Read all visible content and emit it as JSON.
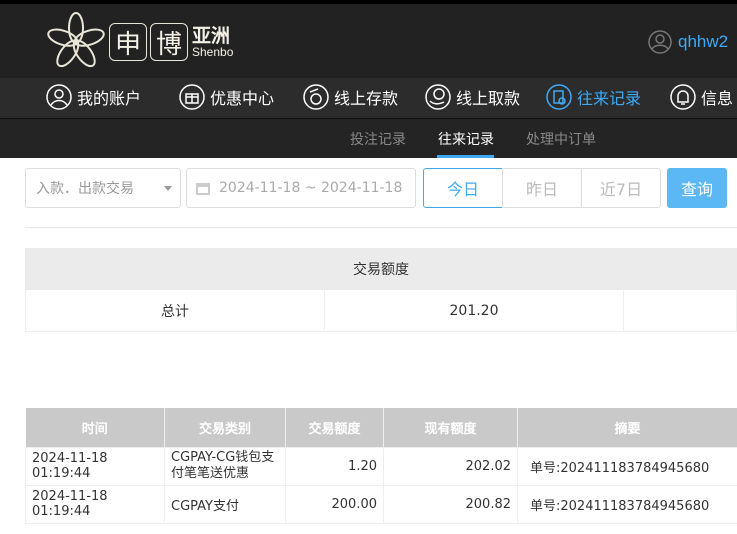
{
  "brand": {
    "char1": "申",
    "char2": "博",
    "cn": "亚洲",
    "en": "Shenbo"
  },
  "user": {
    "name": "qhhw2",
    "icon": "user-circle-icon"
  },
  "nav": [
    {
      "label": "我的账户",
      "icon": "user-icon"
    },
    {
      "label": "优惠中心",
      "icon": "gift-icon"
    },
    {
      "label": "线上存款",
      "icon": "deposit-icon"
    },
    {
      "label": "线上取款",
      "icon": "withdraw-icon"
    },
    {
      "label": "往来记录",
      "icon": "records-icon",
      "active": true
    },
    {
      "label": "信息",
      "icon": "bell-icon"
    }
  ],
  "subnav": [
    {
      "label": "投注记录"
    },
    {
      "label": "往来记录",
      "active": true
    },
    {
      "label": "处理中订单"
    }
  ],
  "filters": {
    "type": "入款．出款交易",
    "date_range": "2024-11-18 ~ 2024-11-18",
    "quick": [
      "今日",
      "昨日",
      "近7日"
    ],
    "search": "查询"
  },
  "summary": {
    "header": "交易额度",
    "label": "总计",
    "value": "201.20"
  },
  "table": {
    "headers": [
      "时间",
      "交易类别",
      "交易额度",
      "现有额度",
      "摘要"
    ],
    "rows": [
      [
        "2024-11-18 01:19:44",
        "CGPAY-CG钱包支付笔笔送优惠",
        "1.20",
        "202.02",
        "单号:202411183784945680"
      ],
      [
        "2024-11-18 01:19:44",
        "CGPAY支付",
        "200.00",
        "200.82",
        "单号:202411183784945680"
      ]
    ]
  },
  "colors": {
    "accent": "#3fa9f5",
    "header_bg": "#222222"
  }
}
